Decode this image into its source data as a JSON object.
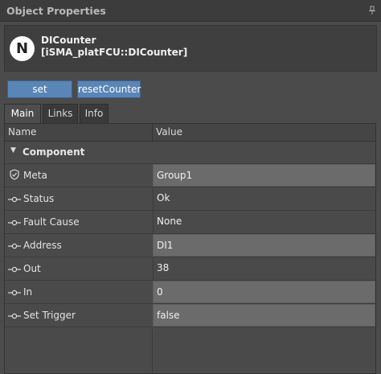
{
  "window": {
    "title": "Object Properties"
  },
  "object": {
    "icon_letter": "N",
    "name": "DICounter",
    "type": "[iSMA_platFCU::DICounter]"
  },
  "actions": {
    "set_label": "set",
    "reset_label": "resetCounter"
  },
  "tabs": [
    {
      "label": "Main",
      "active": true
    },
    {
      "label": "Links",
      "active": false
    },
    {
      "label": "Info",
      "active": false
    }
  ],
  "table": {
    "columns": {
      "name": "Name",
      "value": "Value"
    },
    "group": "Component",
    "rows": [
      {
        "name": "Meta",
        "value": "Group1",
        "icon": "shield-icon",
        "editable": true
      },
      {
        "name": "Status",
        "value": "Ok",
        "icon": "slot-icon",
        "editable": false
      },
      {
        "name": "Fault Cause",
        "value": "None",
        "icon": "slot-icon",
        "editable": false
      },
      {
        "name": "Address",
        "value": "DI1",
        "icon": "slot-icon",
        "editable": true
      },
      {
        "name": "Out",
        "value": "38",
        "icon": "slot-icon",
        "editable": false
      },
      {
        "name": "In",
        "value": "0",
        "icon": "slot-icon",
        "editable": true
      },
      {
        "name": "Set Trigger",
        "value": "false",
        "icon": "slot-icon",
        "editable": true
      }
    ]
  }
}
